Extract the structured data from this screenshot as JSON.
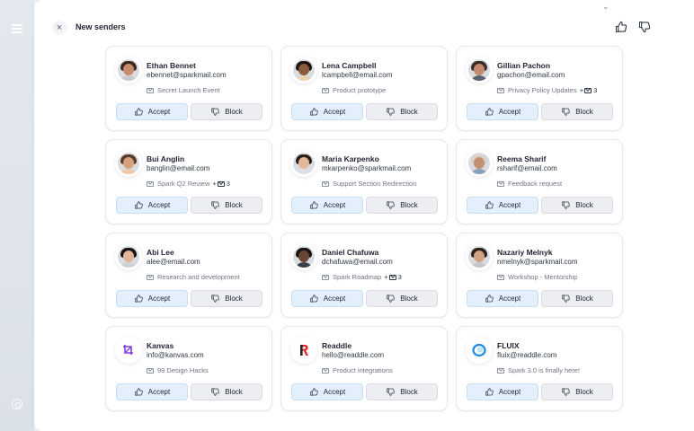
{
  "header": {
    "title": "New senders",
    "close_icon": "×",
    "top_icon": "⌄"
  },
  "icons": {
    "accept": "thumbs-up-icon",
    "block": "thumbs-down-icon",
    "subject": "mail-icon"
  },
  "colors": {
    "accept_bg": "#e3f0fc",
    "block_bg": "#eceef1",
    "sidebar": "#dbe1e8"
  },
  "senders": [
    {
      "name": "Ethan Bennet",
      "email": "ebennet@sparkmail.com",
      "subject": "Secret Launch Event",
      "more": "",
      "accept": "Accept",
      "block": "Block",
      "avatar": "person-avatar"
    },
    {
      "name": "Lena Campbell",
      "email": "lcampbell@email.com",
      "subject": "Product prototype",
      "more": "",
      "accept": "Accept",
      "block": "Block",
      "avatar": "person-avatar"
    },
    {
      "name": "Gillian Pachon",
      "email": "gpachon@email.com",
      "subject": "Privacy Policy Updates",
      "more": "3",
      "accept": "Accept",
      "block": "Block",
      "avatar": "person-avatar"
    },
    {
      "name": "Bui Anglin",
      "email": "banglin@email.com",
      "subject": "Spark Q2 Review",
      "more": "3",
      "accept": "Accept",
      "block": "Block",
      "avatar": "person-avatar"
    },
    {
      "name": "Maria Karpenko",
      "email": "mkarpenko@sparkmail.com",
      "subject": "Support Section Redirection",
      "more": "",
      "accept": "Accept",
      "block": "Block",
      "avatar": "person-avatar"
    },
    {
      "name": "Reema Sharif",
      "email": "rsharif@email.com",
      "subject": "Feedback request",
      "more": "",
      "accept": "Accept",
      "block": "Block",
      "avatar": "person-avatar"
    },
    {
      "name": "Abi Lee",
      "email": "alee@email.com",
      "subject": "Research and development",
      "more": "",
      "accept": "Accept",
      "block": "Block",
      "avatar": "person-avatar"
    },
    {
      "name": "Daniel Chafuwa",
      "email": "dchafuwa@email.com",
      "subject": "Spark Roadmap",
      "more": "3",
      "accept": "Accept",
      "block": "Block",
      "avatar": "person-avatar"
    },
    {
      "name": "Nazariy Melnyk",
      "email": "nmelnyk@sparkmail.com",
      "subject": "Workshop - Mentorship",
      "more": "",
      "accept": "Accept",
      "block": "Block",
      "avatar": "person-avatar"
    },
    {
      "name": "Kanvas",
      "email": "info@kanvas.com",
      "subject": "99 Design Hacks",
      "more": "",
      "accept": "Accept",
      "block": "Block",
      "avatar": "kanvas-logo"
    },
    {
      "name": "Readdle",
      "email": "hello@readdle.com",
      "subject": "Product integrations",
      "more": "",
      "accept": "Accept",
      "block": "Block",
      "avatar": "readdle-logo"
    },
    {
      "name": "FLUIX",
      "email": "fluix@readdle.com",
      "subject": "Spark 3.0 is finally here!",
      "more": "",
      "accept": "Accept",
      "block": "Block",
      "avatar": "fluix-logo"
    }
  ]
}
